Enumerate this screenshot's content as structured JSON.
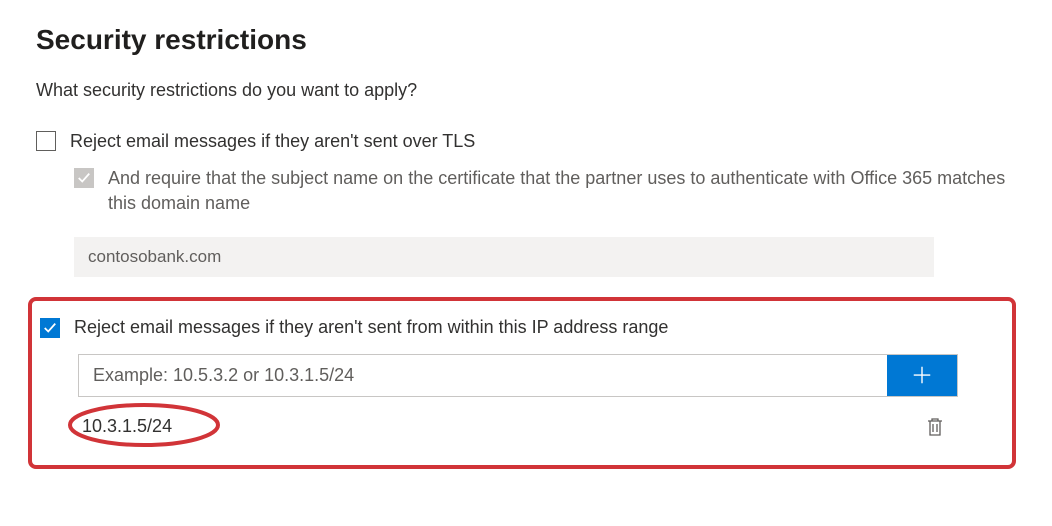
{
  "page": {
    "title": "Security restrictions",
    "subtitle": "What security restrictions do you want to apply?"
  },
  "options": {
    "tls": {
      "label": "Reject email messages if they aren't sent over TLS",
      "checked": false,
      "sub": {
        "label": "And require that the subject name on the certificate that the partner uses to authenticate with Office 365 matches this domain name",
        "checked": false,
        "domain_value": "contosobank.com"
      }
    },
    "ip": {
      "label": "Reject email messages if they aren't sent from within this IP address range",
      "checked": true,
      "input_placeholder": "Example: 10.5.3.2 or 10.3.1.5/24",
      "entries": [
        "10.3.1.5/24"
      ]
    }
  },
  "colors": {
    "accent": "#0078d4",
    "annotation": "#d13438"
  }
}
